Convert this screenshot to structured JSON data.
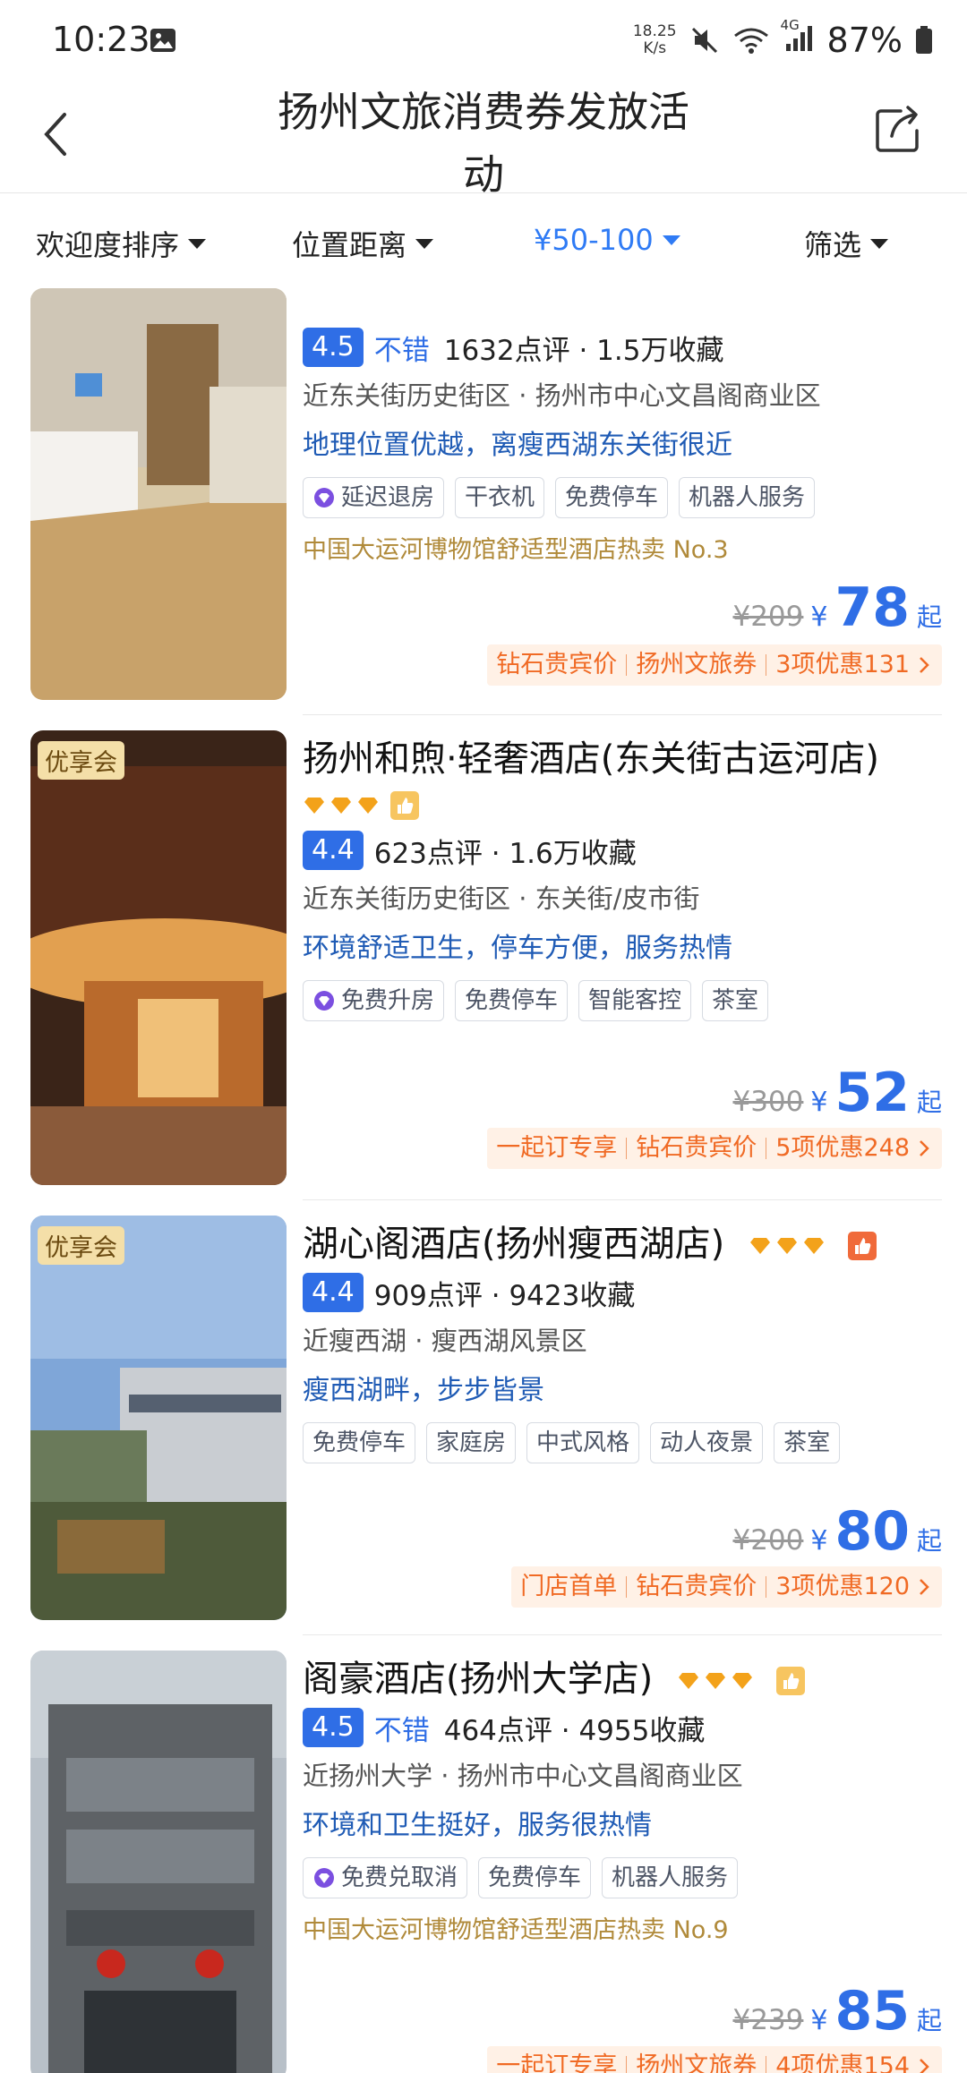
{
  "status_bar": {
    "time": "10:23",
    "net_speed_top": "18.25",
    "net_speed_bottom": "K/s",
    "signal": "4G",
    "battery": "87%"
  },
  "header": {
    "title_line1": "扬州文旅消费券发放活",
    "title_line2": "动"
  },
  "filters": [
    {
      "label": "欢迎度排序",
      "active": false
    },
    {
      "label": "位置距离",
      "active": false
    },
    {
      "label": "¥50-100",
      "active": true
    },
    {
      "label": "筛选",
      "active": false
    }
  ],
  "hotels": [
    {
      "name": "",
      "score": "4.5",
      "score_label": "不错",
      "reviews": "1632点评 · 1.5万收藏",
      "location": "近东关街历史街区 · 扬州市中心文昌阁商业区",
      "highlight": "地理位置优越，离瘦西湖东关街很近",
      "tags": [
        "延迟退房",
        "干衣机",
        "免费停车",
        "机器人服务"
      ],
      "vip_tag_index": 0,
      "rank": "中国大运河博物馆舒适型酒店热卖 No.3",
      "old_price": "¥209",
      "currency": "¥",
      "price": "78",
      "suffix": "起",
      "promos": [
        "钻石贵宾价",
        "扬州文旅券",
        "3项优惠131"
      ]
    },
    {
      "name": "扬州和煦·轻奢酒店(东关街古运河店)",
      "ribbon": "优享会",
      "score": "4.4",
      "score_label": "",
      "reviews": "623点评 · 1.6万收藏",
      "location": "近东关街历史街区 · 东关街/皮市街",
      "highlight": "环境舒适卫生，停车方便，服务热情",
      "tags": [
        "免费升房",
        "免费停车",
        "智能客控",
        "茶室"
      ],
      "vip_tag_index": 0,
      "rank": "",
      "old_price": "¥300",
      "currency": "¥",
      "price": "52",
      "suffix": "起",
      "promos": [
        "一起订专享",
        "钻石贵宾价",
        "5项优惠248"
      ]
    },
    {
      "name": "湖心阁酒店(扬州瘦西湖店)",
      "ribbon": "优享会",
      "score": "4.4",
      "score_label": "",
      "reviews": "909点评 · 9423收藏",
      "location": "近瘦西湖 · 瘦西湖风景区",
      "highlight": "瘦西湖畔，步步皆景",
      "tags": [
        "免费停车",
        "家庭房",
        "中式风格",
        "动人夜景",
        "茶室"
      ],
      "vip_tag_index": -1,
      "rank": "",
      "old_price": "¥200",
      "currency": "¥",
      "price": "80",
      "suffix": "起",
      "promos": [
        "门店首单",
        "钻石贵宾价",
        "3项优惠120"
      ]
    },
    {
      "name": "阁豪酒店(扬州大学店)",
      "score": "4.5",
      "score_label": "不错",
      "reviews": "464点评 · 4955收藏",
      "location": "近扬州大学 · 扬州市中心文昌阁商业区",
      "highlight": "环境和卫生挺好，服务很热情",
      "tags": [
        "免费兑取消",
        "免费停车",
        "机器人服务"
      ],
      "vip_tag_index": 0,
      "rank": "中国大运河博物馆舒适型酒店热卖 No.9",
      "old_price": "¥239",
      "currency": "¥",
      "price": "85",
      "suffix": "起",
      "promos": [
        "一起订专享",
        "扬州文旅券",
        "4项优惠154"
      ]
    }
  ],
  "colors": {
    "accent": "#2f6ee6",
    "promo": "#f06a24",
    "rank": "#b08a3a"
  }
}
